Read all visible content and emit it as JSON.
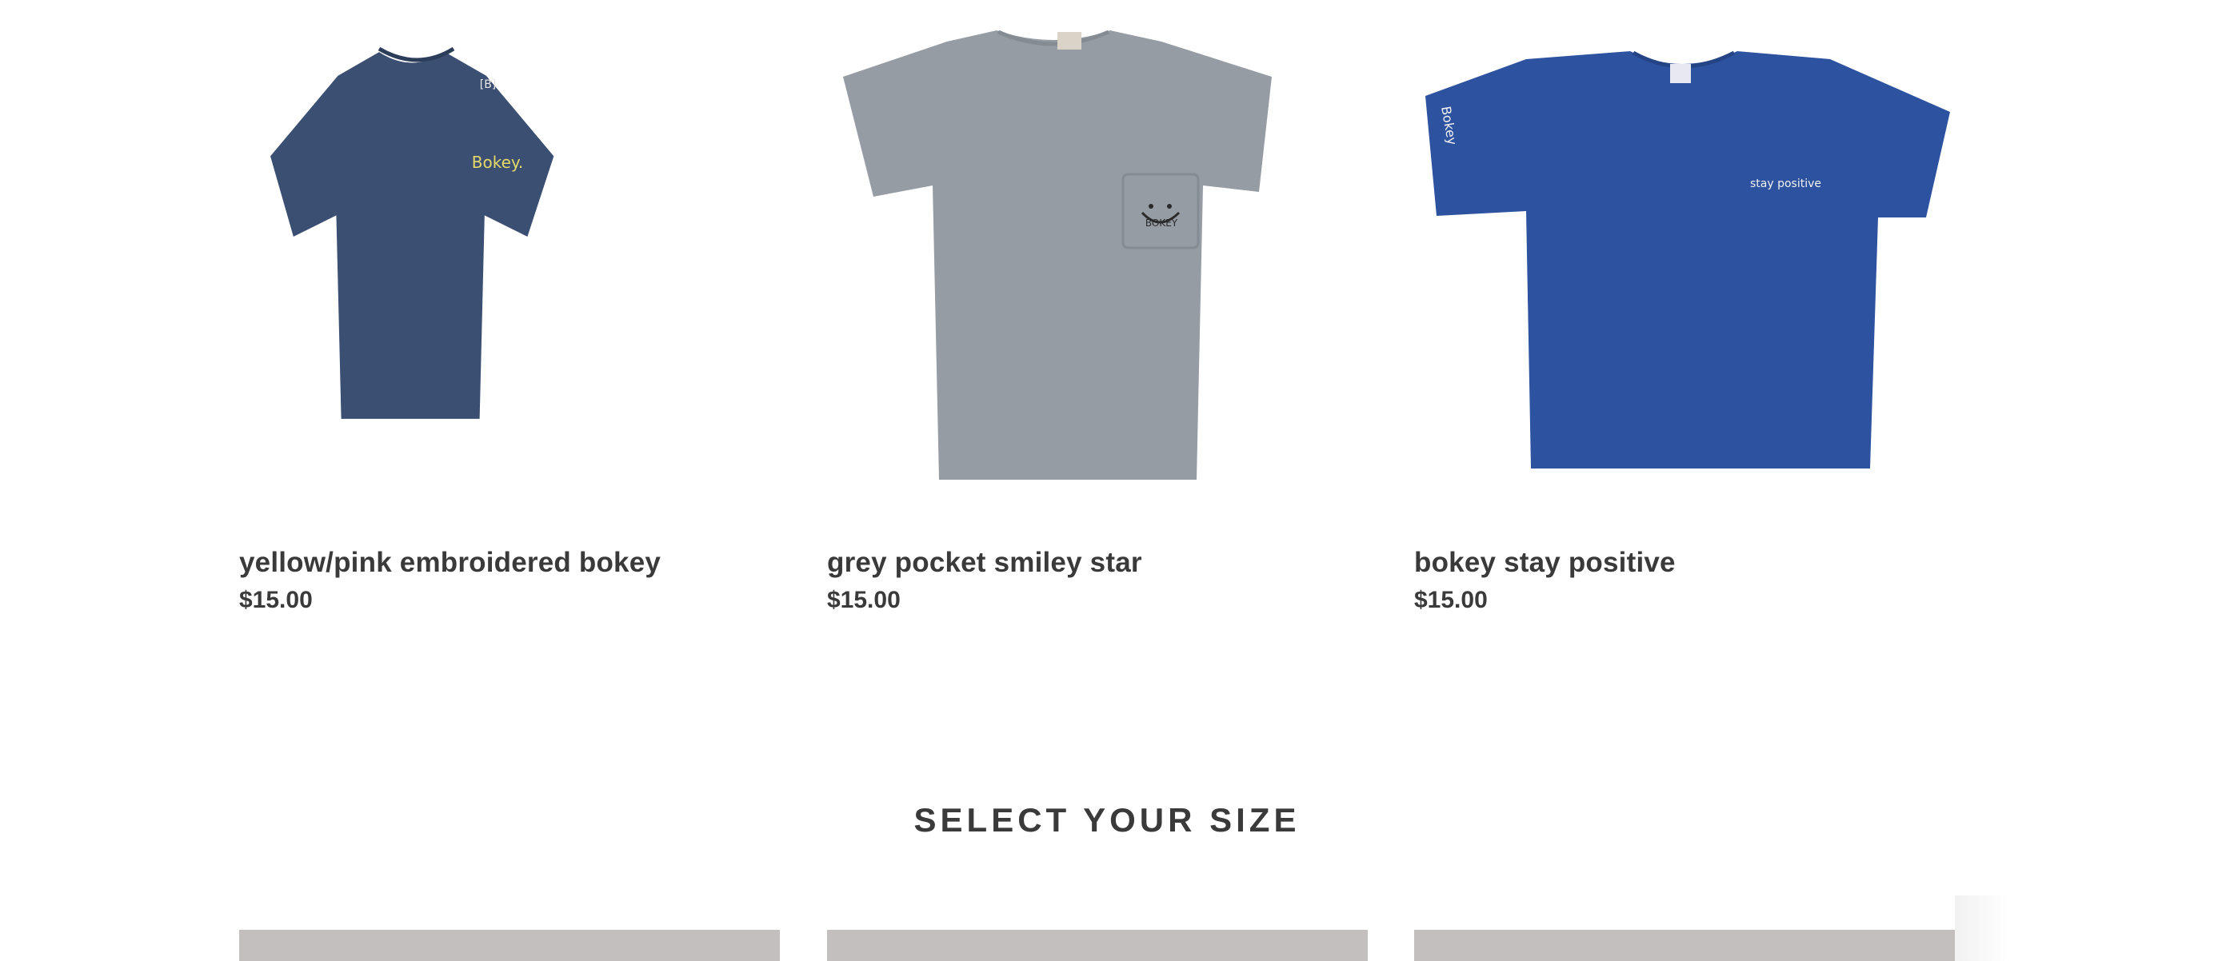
{
  "products": [
    {
      "title": "yellow/pink embroidered bokey",
      "price": "$15.00",
      "image": {
        "icon": "navy-tshirt-icon",
        "shirt_color": "#3b4f72",
        "print_text": "Bokey.",
        "tag_text": "[B]"
      }
    },
    {
      "title": "grey pocket smiley star",
      "price": "$15.00",
      "image": {
        "icon": "grey-pocket-tshirt-icon",
        "shirt_color": "#959ca4",
        "print_text": "BOKEY"
      }
    },
    {
      "title": "bokey stay positive",
      "price": "$15.00",
      "image": {
        "icon": "blue-tshirt-icon",
        "shirt_color": "#2d52a0",
        "print_text": "stay positive",
        "sleeve_text": "Bokey"
      }
    }
  ],
  "sections": {
    "size_heading": "SELECT YOUR SIZE"
  },
  "colors": {
    "text": "#3a3a3a",
    "size_tile": "#c3bfbf",
    "background": "#ffffff"
  }
}
